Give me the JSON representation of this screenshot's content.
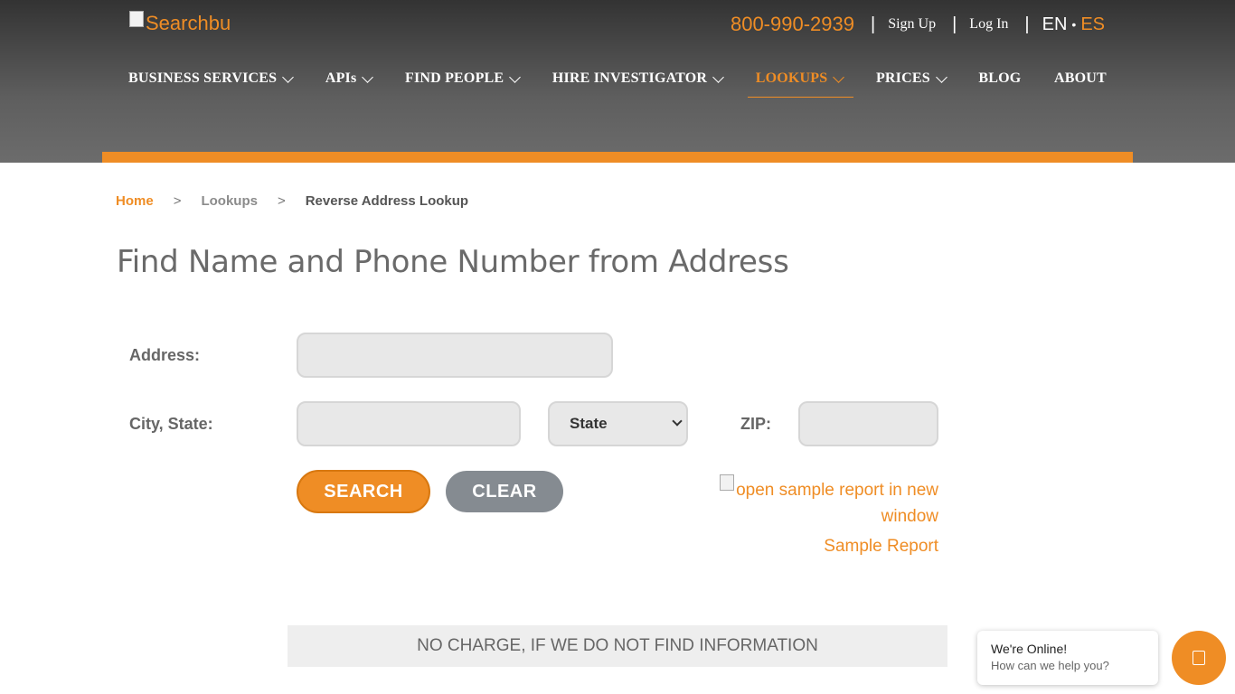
{
  "header": {
    "logo_alt": "Searchbu",
    "phone": "800-990-2939",
    "sign_up": "Sign Up",
    "log_in": "Log In",
    "lang_en": "EN",
    "lang_es": "ES",
    "separator": "|",
    "dot": "•"
  },
  "nav": {
    "items": [
      {
        "label": "BUSINESS SERVICES"
      },
      {
        "label": "APIs"
      },
      {
        "label": "FIND PEOPLE"
      },
      {
        "label": "HIRE INVESTIGATOR"
      },
      {
        "label": "LOOKUPS"
      },
      {
        "label": "PRICES"
      },
      {
        "label": "BLOG"
      },
      {
        "label": "ABOUT"
      }
    ],
    "active": "LOOKUPS"
  },
  "breadcrumb": {
    "home": "Home",
    "sep": ">",
    "lookups": "Lookups",
    "current": "Reverse Address Lookup"
  },
  "page": {
    "title": "Find Name and Phone Number from Address"
  },
  "form": {
    "address_label": "Address:",
    "address_value": "",
    "city_state_label": "City, State:",
    "city_value": "",
    "state_selected": "State",
    "zip_label": "ZIP:",
    "zip_value": "",
    "search_label": "SEARCH",
    "clear_label": "CLEAR"
  },
  "sample": {
    "image_alt": "open sample report in new window",
    "link": "Sample Report"
  },
  "notice": "NO CHARGE, IF WE DO NOT FIND INFORMATION",
  "chat": {
    "title": "We're Online!",
    "subtitle": "How can we help you?",
    "icon": "chat-icon"
  },
  "colors": {
    "accent": "#ef8d25",
    "clear_button": "#858b91",
    "header_dark": "#333333"
  }
}
